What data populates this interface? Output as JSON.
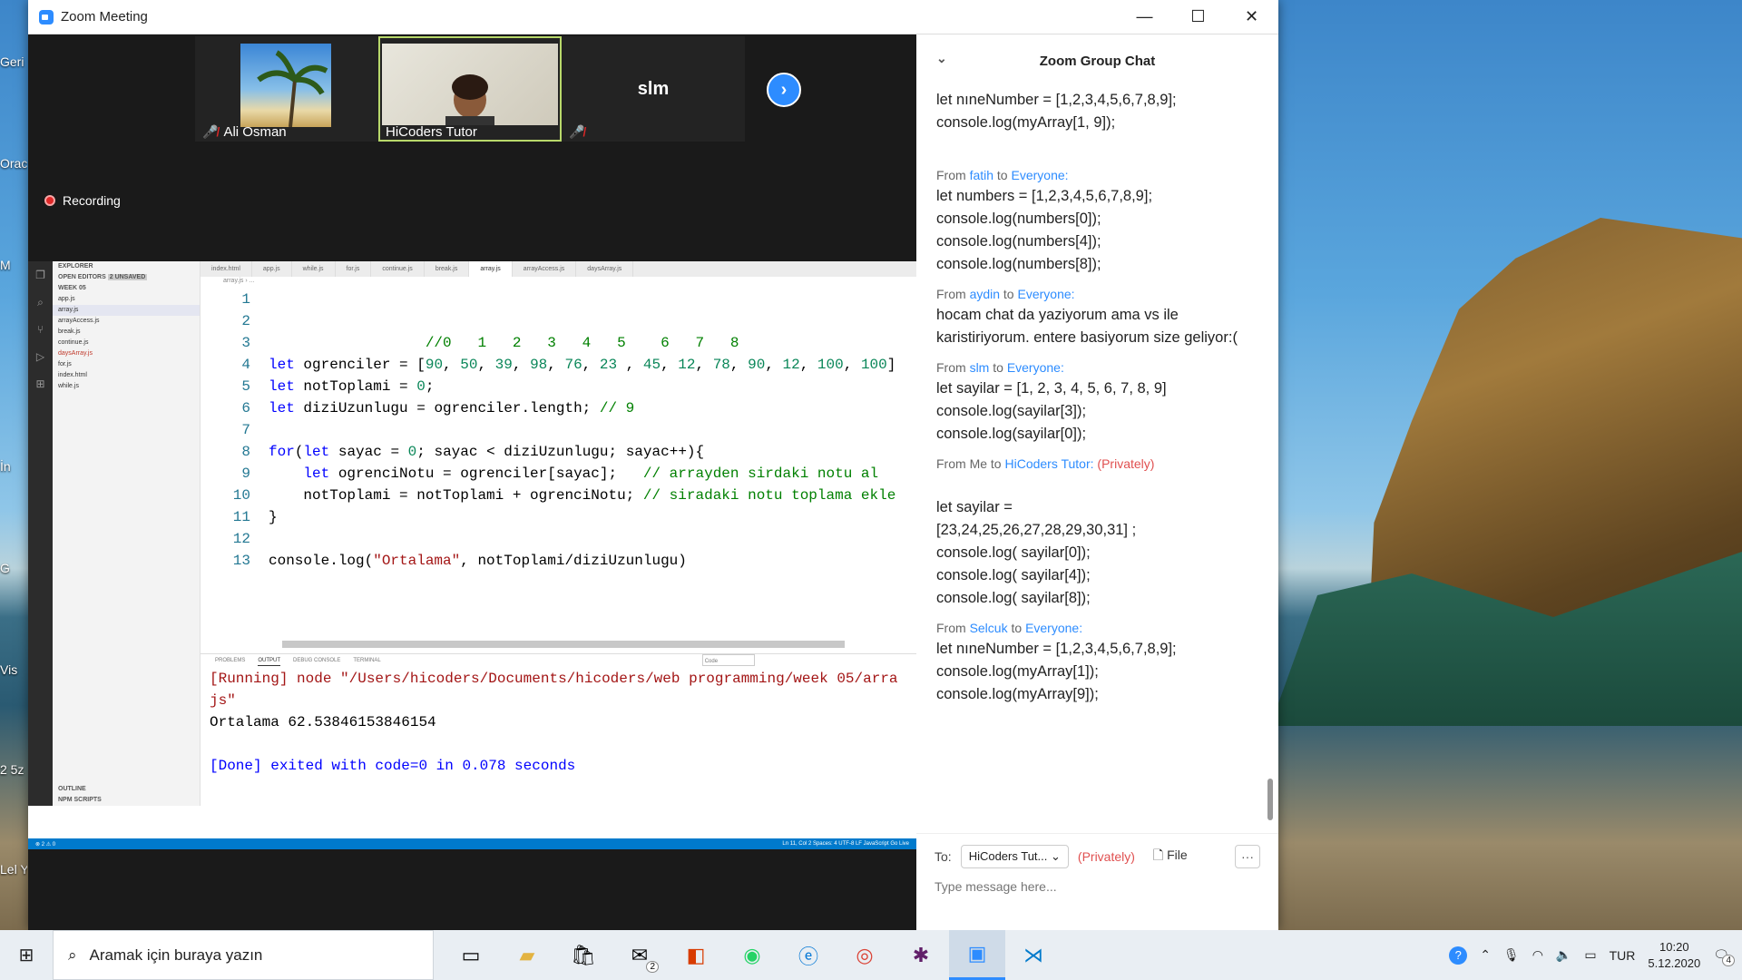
{
  "desktop": {
    "icon_labels": [
      "Geri",
      "Orac",
      "M",
      "İn",
      "G",
      "Vis",
      "2 5z",
      "Lel Y"
    ]
  },
  "window": {
    "title": "Zoom Meeting",
    "controls": [
      "—",
      "☐",
      "✕"
    ]
  },
  "participants": [
    {
      "name": "Ali Osman",
      "muted": true
    },
    {
      "name": "HiCoders Tutor",
      "muted": false
    },
    {
      "name": "slm",
      "muted": true
    }
  ],
  "recording": {
    "label": "Recording"
  },
  "vscode": {
    "explorer_title": "EXPLORER",
    "open_editors": "OPEN EDITORS",
    "unsaved": "2 UNSAVED",
    "folder": "WEEK 05",
    "files": [
      "app.js",
      "array.js",
      "arrayAccess.js",
      "break.js",
      "continue.js",
      "daysArray.js",
      "for.js",
      "index.html",
      "while.js"
    ],
    "outline": "OUTLINE",
    "npm_scripts": "NPM SCRIPTS",
    "tabs": [
      "index.html",
      "app.js",
      "while.js",
      "for.js",
      "continue.js",
      "break.js",
      "array.js",
      "arrayAccess.js",
      "daysArray.js"
    ],
    "breadcrumb": "array.js › ...",
    "code_lines": [
      {
        "n": "1",
        "html": ""
      },
      {
        "n": "2",
        "html": ""
      },
      {
        "n": "3",
        "html": "                  <span class='cm'>//0   1   2   3   4   5    6   7   8</span>"
      },
      {
        "n": "4",
        "html": "<span class='kw'>let</span> ogrenciler = [<span class='num'>90</span>, <span class='num'>50</span>, <span class='num'>39</span>, <span class='num'>98</span>, <span class='num'>76</span>, <span class='num'>23</span> , <span class='num'>45</span>, <span class='num'>12</span>, <span class='num'>78</span>, <span class='num'>90</span>, <span class='num'>12</span>, <span class='num'>100</span>, <span class='num'>100</span>]"
      },
      {
        "n": "5",
        "html": "<span class='kw'>let</span> notToplami = <span class='num'>0</span>;"
      },
      {
        "n": "6",
        "html": "<span class='kw'>let</span> diziUzunlugu = ogrenciler.length; <span class='cm'>// 9</span>"
      },
      {
        "n": "7",
        "html": ""
      },
      {
        "n": "8",
        "html": "<span class='kw'>for</span>(<span class='kw'>let</span> sayac = <span class='num'>0</span>; sayac &lt; diziUzunlugu; sayac++){"
      },
      {
        "n": "9",
        "html": "    <span class='kw'>let</span> ogrenciNotu = ogrenciler[sayac];   <span class='cm'>// arrayden sirdaki notu al</span>"
      },
      {
        "n": "10",
        "html": "    notToplami = notToplami + ogrenciNotu; <span class='cm'>// siradaki notu toplama ekle</span>"
      },
      {
        "n": "11",
        "html": "}"
      },
      {
        "n": "12",
        "html": ""
      },
      {
        "n": "13",
        "html": "console.log(<span class='str'>\"Ortalama\"</span>, notToplami/diziUzunlugu)"
      }
    ],
    "panel_tabs": [
      "PROBLEMS",
      "OUTPUT",
      "DEBUG CONSOLE",
      "TERMINAL"
    ],
    "panel_select": "Code",
    "output_lines": [
      "[Running] node \"/Users/hicoders/Documents/hicoders/web programming/week 05/array.",
      "js\"",
      "Ortalama 62.53846153846154",
      "",
      "[Done] exited with code=0 in 0.078 seconds"
    ],
    "status_left": "⊗ 2 ⚠ 0",
    "status_right": "Ln 11, Col 2   Spaces: 4   UTF-8   LF   JavaScript   Go Live"
  },
  "chat": {
    "title": "Zoom Group Chat",
    "messages": [
      {
        "from": "",
        "to": "",
        "private": "",
        "body": "let nıneNumber = [1,2,3,4,5,6,7,8,9];\nconsole.log(myArray[1, 9]);\n\n"
      },
      {
        "from": "fatih",
        "to": "Everyone",
        "private": "",
        "body": "let numbers = [1,2,3,4,5,6,7,8,9];\nconsole.log(numbers[0]);\nconsole.log(numbers[4]);\nconsole.log(numbers[8]);"
      },
      {
        "from": "aydin",
        "to": "Everyone",
        "private": "",
        "body": "hocam chat da yaziyorum ama vs ile karistiriyorum. entere basiyorum size geliyor:("
      },
      {
        "from": "slm",
        "to": "Everyone",
        "private": "",
        "body": "let sayilar = [1, 2, 3, 4, 5, 6, 7, 8, 9]\nconsole.log(sayilar[3]);\nconsole.log(sayilar[0]);"
      },
      {
        "from": "Me",
        "to": "HiCoders Tutor",
        "private": "(Privately)",
        "body": "\nlet sayilar =\n[23,24,25,26,27,28,29,30,31] ;\nconsole.log( sayilar[0]);\nconsole.log( sayilar[4]);\nconsole.log( sayilar[8]);"
      },
      {
        "from": "Selcuk",
        "to": "Everyone",
        "private": "",
        "body": "let nıneNumber = [1,2,3,4,5,6,7,8,9];\nconsole.log(myArray[1]);\nconsole.log(myArray[9]);"
      }
    ],
    "from_word": "From",
    "to_word": "to",
    "to_label": "To:",
    "recipient": "HiCoders Tut...",
    "privately": "(Privately)",
    "file_label": "File",
    "placeholder": "Type message here..."
  },
  "taskbar": {
    "search_placeholder": "Aramak için buraya yazın",
    "mail_badge": "2",
    "lang": "TUR",
    "time": "10:20",
    "date": "5.12.2020",
    "notif_count": "4"
  },
  "colors": {
    "zoom_blue": "#2d8cff",
    "vscode_blue": "#007acc",
    "private_red": "#e05050"
  }
}
